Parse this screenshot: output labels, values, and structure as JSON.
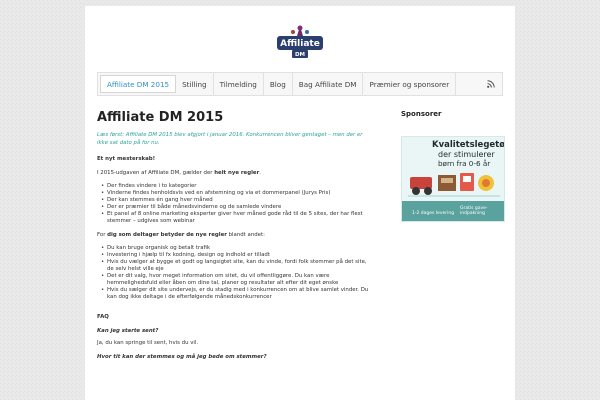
{
  "header": {
    "logo_text": "Affiliate",
    "logo_sub": "DM"
  },
  "nav": {
    "items": [
      "Affiliate DM 2015",
      "Stilling",
      "Tilmelding",
      "Blog",
      "Bag Affiliate DM",
      "Præmier og sponsorer"
    ],
    "rss_icon": "rss-icon"
  },
  "main": {
    "title": "Affiliate DM 2015",
    "lead": "Læs først: Affiliate DM 2015 blev afgjort i januar 2016. Konkurrencen bliver gentaget – men der er ikke sat dato på for nu.",
    "subtitle": "Et nyt mesterskab!",
    "intro_pre": "I 2015-udgaven af Affiliate DM, gælder der",
    "intro_bold": "helt nye regler",
    "intro_post": ".",
    "list1": [
      "Der findes vindere i to kategorier",
      "Vinderne findes henholdsvis ved en afstemning og via et dommerpanel (Jurys Pris)",
      "Der kan stemmes én gang hver måned",
      "Der er præmier til både månedsvinderne og de samlede vindere",
      "Et panel af 8 online marketing eksperter giver hver måned gode råd til de 5 sites, der har flest stemmer – udgives som webinar"
    ],
    "rules_pre": "For",
    "rules_bold": "dig som deltager betyder de nye regler",
    "rules_post": "blandt andet:",
    "list2": [
      "Du kan bruge organisk og betalt trafik",
      "Investering i hjælp til fx kodning, design og indhold er tilladt",
      "Hvis du vælger at bygge et godt og langsigtet site, kan du vinde, fordi folk stemmer på det site, de selv helst ville eje",
      "Det er dit valg, hvor meget information om sitet, du vil offentliggøre. Du kan være hemmelighedsfuld eller åben om dine tal, planer og resultater alt efter dit eget ønske",
      "Hvis du sælger dit site undervejs, er du stadig med i konkurrencen om at blive samlet vinder. Du kan dog ikke deltage i de efterfølgende månedskonkurrencer"
    ],
    "faq_label": "FAQ",
    "faq1_q": "Kan jeg starte sent?",
    "faq1_a": "Ja, du kan springe til sent, hvis du vil.",
    "faq2_q": "Hvor tit kan der stemmes og må jeg bede om stemmer?"
  },
  "sidebar": {
    "title": "Sponsorer",
    "ad_line1": "Kvalitetslegetøj",
    "ad_line2": "der stimulerer",
    "ad_line3": "børn fra 0-6 år",
    "ad_badge1": "1-2 dages levering",
    "ad_badge2": "Gratis gave-indpakning"
  },
  "colors": {
    "accent": "#2e93c4",
    "lead": "#2aa39a",
    "ad_bar": "#5aa29d"
  }
}
